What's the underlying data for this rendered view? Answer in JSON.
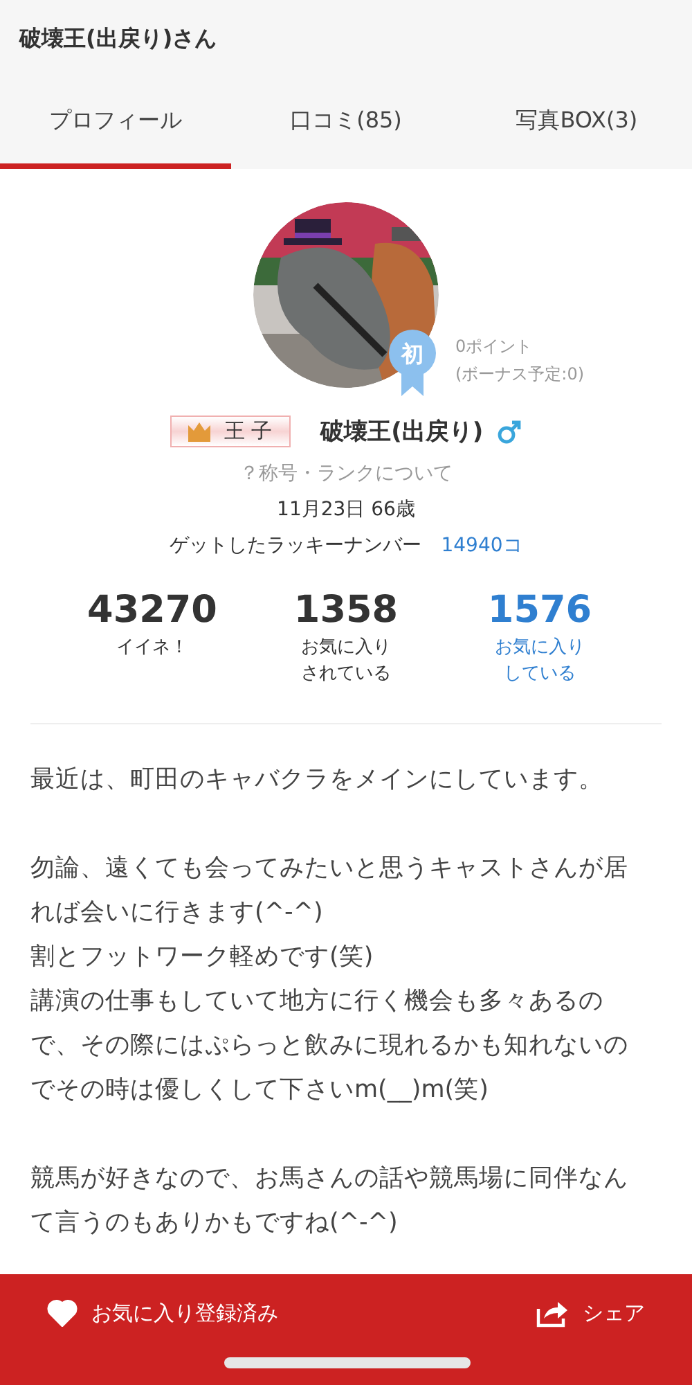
{
  "header": {
    "title": "破壊王(出戻り)さん"
  },
  "tabs": [
    {
      "label": "プロフィール",
      "selected": true
    },
    {
      "label": "口コミ(85)",
      "selected": false
    },
    {
      "label": "写真BOX(3)",
      "selected": false
    }
  ],
  "profile": {
    "first_badge": "初",
    "points": "0ポイント",
    "bonus": "(ボーナス予定:0)",
    "rank": "王 子",
    "name": "破壊王(出戻り)",
    "male": true,
    "rank_link": "？称号・ランクについて",
    "birthday": "11月23日 66歳",
    "lucky_label": "ゲットしたラッキーナンバー",
    "lucky_value": "14940コ"
  },
  "stats": [
    {
      "value": "43270",
      "label": [
        "イイネ！"
      ],
      "highlighted": false
    },
    {
      "value": "1358",
      "label": [
        "お気に入り",
        "されている"
      ],
      "highlighted": false
    },
    {
      "value": "1576",
      "label": [
        "お気に入り",
        "している"
      ],
      "highlighted": true
    }
  ],
  "bio": [
    "最近は、町田のキャバクラをメインにしています。",
    "勿論、遠くても会ってみたいと思うキャストさんが居れば会いに行きます(^-^)\n割とフットワーク軽めです(笑)\n講演の仕事もしていて地方に行く機会も多々あるので、その際にはぷらっと飲みに現れるかも知れないのでその時は優しくして下さいm(__)m(笑)",
    "競馬が好きなので、お馬さんの話や競馬場に同伴なんて言うのもありかもですね(^-^)"
  ],
  "bottom_bar": {
    "favorite": {
      "label": "お気に入り登録済み",
      "registered": true
    },
    "share": {
      "label": "シェア"
    }
  }
}
